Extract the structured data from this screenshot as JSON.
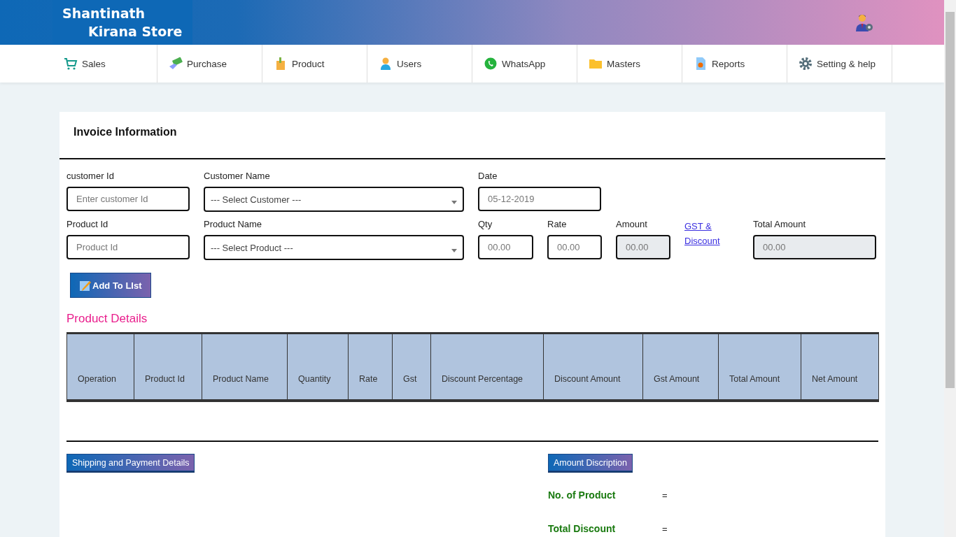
{
  "header": {
    "logo_lines": [
      "Shantinath",
      "Kirana Store"
    ]
  },
  "nav": [
    {
      "label": "Sales"
    },
    {
      "label": "Purchase"
    },
    {
      "label": "Product"
    },
    {
      "label": "Users"
    },
    {
      "label": "WhatsApp"
    },
    {
      "label": "Masters"
    },
    {
      "label": "Reports"
    },
    {
      "label": "Setting & help"
    }
  ],
  "invoice": {
    "title": "Invoice Information",
    "rows": [
      [
        {
          "label": "customer Id",
          "kind": "input",
          "placeholder": "Enter customer Id"
        },
        {
          "label": "Customer Name",
          "kind": "select",
          "value": "--- Select Customer ---"
        },
        {
          "label": "Date",
          "kind": "input",
          "placeholder": "05-12-2019"
        }
      ],
      [
        {
          "label": "Product Id",
          "kind": "input",
          "placeholder": "Product Id"
        },
        {
          "label": "Product Name",
          "kind": "select",
          "value": "--- Select Product ---"
        },
        {
          "label": "Qty",
          "kind": "input",
          "placeholder": "00.00"
        },
        {
          "label": "Rate",
          "kind": "input",
          "placeholder": "00.00"
        },
        {
          "label": "Amount",
          "kind": "input",
          "placeholder": "00.00",
          "disabled": true
        },
        {
          "label": "GST & Discount",
          "kind": "link"
        },
        {
          "label": "Total Amount",
          "kind": "input",
          "placeholder": "00.00",
          "disabled": true
        }
      ]
    ],
    "add_button": "Add To LIst"
  },
  "product_details": {
    "title": "Product Details",
    "columns": [
      "Operation",
      "Product Id",
      "Product Name",
      "Quantity",
      "Rate",
      "Gst",
      "Discount Percentage",
      "Discount Amount",
      "Gst Amount",
      "Total Amount",
      "Net Amount"
    ]
  },
  "shipping": {
    "button": "Shipping and Payment Details"
  },
  "amount": {
    "button": "Amount Discription",
    "rows": [
      {
        "label": "No. of Product",
        "sign": "="
      },
      {
        "label": "Total Discount",
        "sign": "="
      }
    ]
  }
}
